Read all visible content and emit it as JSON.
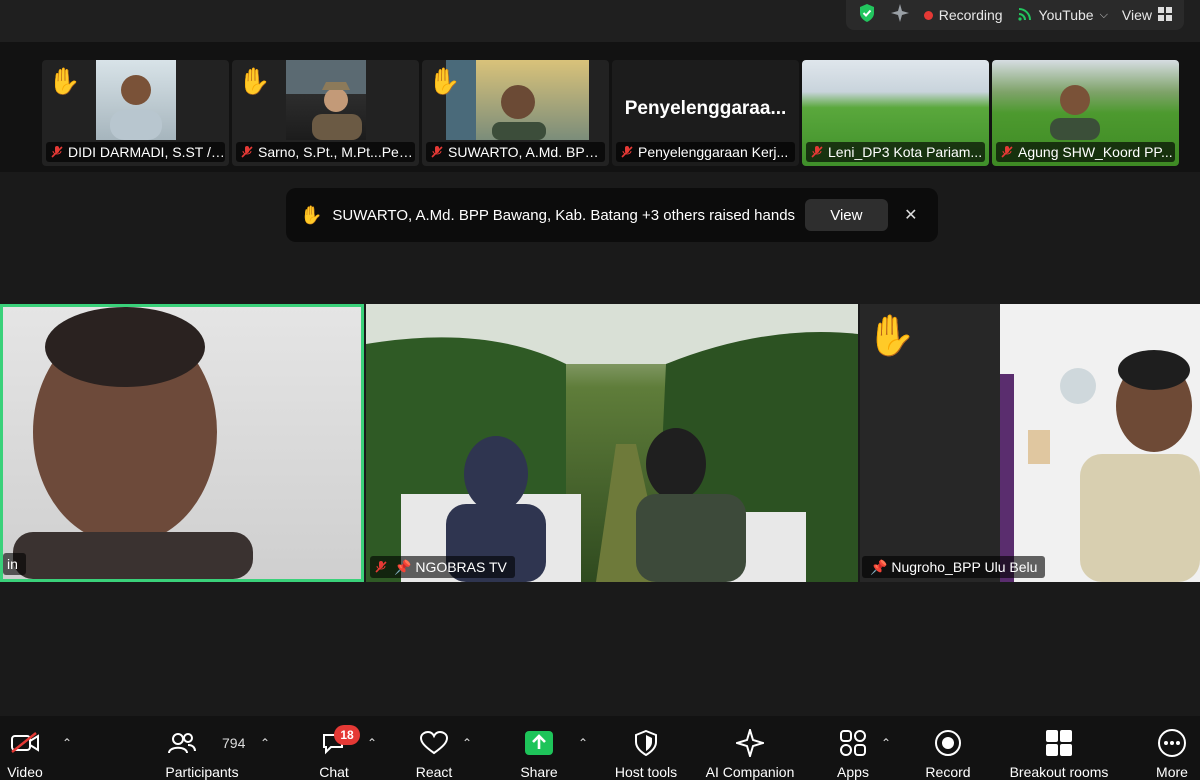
{
  "topbar": {
    "recording": "Recording",
    "youtube": "YouTube",
    "view": "View"
  },
  "thumbnails": [
    {
      "name": "DIDI DARMADI, S.ST / ...",
      "hand": true
    },
    {
      "name": "Sarno, S.Pt., M.Pt...Pen...",
      "hand": true
    },
    {
      "name": "SUWARTO, A.Md. BPP ...",
      "hand": true
    },
    {
      "name": "Penyelenggaraan Kerj...",
      "big": "Penyelenggaraa..."
    },
    {
      "name": "Leni_DP3 Kota Pariam..."
    },
    {
      "name": "Agung SHW_Koord PP..."
    }
  ],
  "notice": {
    "text": "SUWARTO, A.Md. BPP Bawang, Kab. Batang +3 others raised hands",
    "view": "View"
  },
  "tiles": {
    "left_label": "in",
    "center_label": "NGOBRAS TV",
    "right_label": "Nugroho_BPP Ulu Belu"
  },
  "toolbar": {
    "video": "Video",
    "participants": "Participants",
    "participants_count": "794",
    "chat": "Chat",
    "chat_badge": "18",
    "react": "React",
    "share": "Share",
    "host_tools": "Host tools",
    "ai_companion": "AI Companion",
    "apps": "Apps",
    "record": "Record",
    "breakout": "Breakout rooms",
    "more": "More"
  },
  "colors": {
    "active_speaker": "#3ad17a",
    "share_green": "#1ec45a",
    "badge_red": "#e53935",
    "shield_green": "#22c55e"
  }
}
